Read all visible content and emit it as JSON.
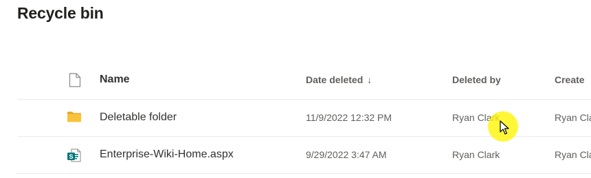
{
  "page": {
    "title": "Recycle bin"
  },
  "columns": {
    "filetype": {
      "icon": "document-icon"
    },
    "name": "Name",
    "date_deleted": "Date deleted",
    "sort_indicator": "↓",
    "deleted_by": "Deleted by",
    "created_by": "Create"
  },
  "rows": [
    {
      "icon": "folder-icon",
      "name": "Deletable folder",
      "date_deleted": "11/9/2022 12:32 PM",
      "deleted_by": "Ryan Clark",
      "created_by": "Ryan Cla"
    },
    {
      "icon": "sharepoint-page-icon",
      "name": "Enterprise-Wiki-Home.aspx",
      "date_deleted": "9/29/2022 3:47 AM",
      "deleted_by": "Ryan Clark",
      "created_by": "Ryan Cla"
    }
  ],
  "colors": {
    "folder": "#F8C33A",
    "sharepoint": "#03787C",
    "cursor_highlight": "#FFF500"
  }
}
